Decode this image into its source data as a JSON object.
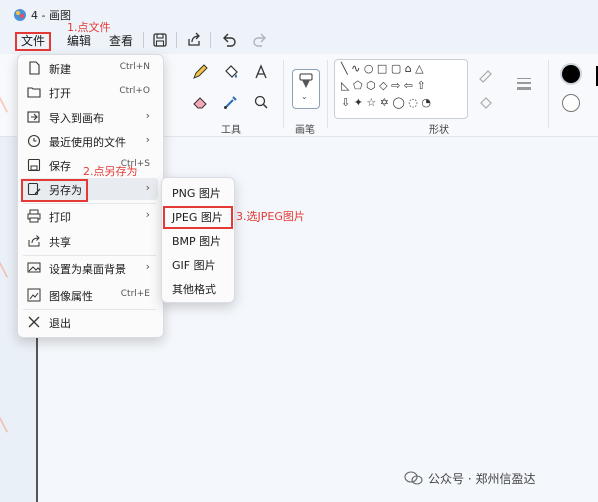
{
  "window": {
    "title": "4 - 画图"
  },
  "menubar": {
    "file": "文件",
    "edit": "编辑",
    "view": "查看"
  },
  "ribbon": {
    "tools_label": "工具",
    "brush_label": "画笔",
    "shapes_label": "形状"
  },
  "file_menu": {
    "items": [
      {
        "label": "新建",
        "shortcut": "Ctrl+N",
        "icon": "new-file-icon"
      },
      {
        "label": "打开",
        "shortcut": "Ctrl+O",
        "icon": "folder-icon"
      },
      {
        "label": "导入到画布",
        "shortcut": "",
        "icon": "import-icon"
      },
      {
        "label": "最近使用的文件",
        "shortcut": "",
        "icon": "clock-icon"
      },
      {
        "label": "保存",
        "shortcut": "Ctrl+S",
        "icon": "save-icon"
      },
      {
        "label": "另存为",
        "shortcut": "",
        "icon": "save-as-icon"
      },
      {
        "label": "打印",
        "shortcut": "",
        "icon": "print-icon"
      },
      {
        "label": "共享",
        "shortcut": "",
        "icon": "share-icon"
      },
      {
        "label": "设置为桌面背景",
        "shortcut": "",
        "icon": "wallpaper-icon"
      },
      {
        "label": "图像属性",
        "shortcut": "Ctrl+E",
        "icon": "image-properties-icon"
      },
      {
        "label": "退出",
        "shortcut": "",
        "icon": "close-icon"
      }
    ]
  },
  "save_as_menu": {
    "items": [
      "PNG 图片",
      "JPEG 图片",
      "BMP 图片",
      "GIF 图片",
      "其他格式"
    ]
  },
  "annotations": {
    "step1": "1.点文件",
    "step2": "2.点另存为",
    "step3": "3.选JPEG图片"
  },
  "watermark": {
    "text": "公众号 · 郑州信盈达"
  },
  "colors": {
    "accent": "#e53935",
    "primary_color": "#000000"
  }
}
